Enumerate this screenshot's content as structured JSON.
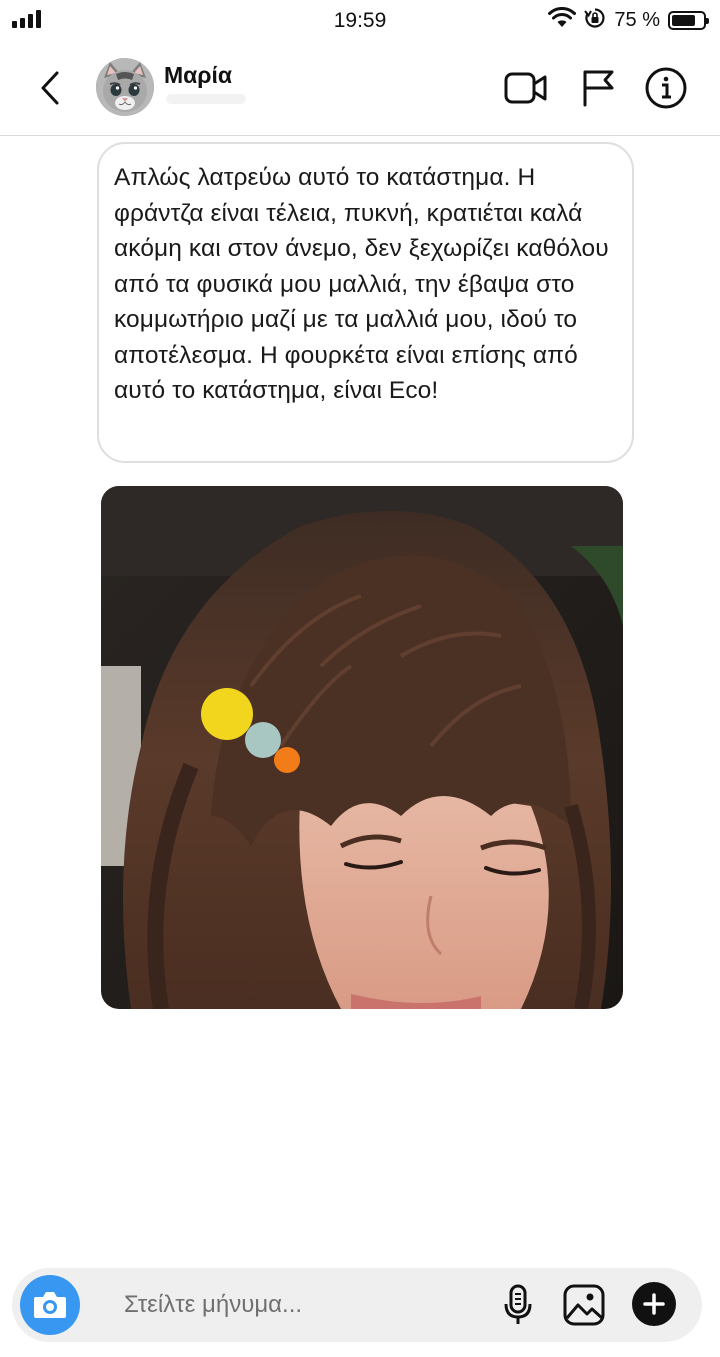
{
  "status_bar": {
    "time": "19:59",
    "battery_percent": "75 %",
    "battery_level": 0.75,
    "signal_bars": 4,
    "icons": [
      "signal-icon",
      "wifi-icon",
      "rotation-lock-icon",
      "battery-icon"
    ]
  },
  "header": {
    "contact_name": "Μαρία",
    "icons": [
      "back-chevron-icon",
      "video-call-icon",
      "flag-icon",
      "info-icon"
    ]
  },
  "conversation": {
    "message_text": "Απλώς λατρεύω αυτό το κατάστημα. Η φράντζα είναι τέλεια, πυκνή, κρατιέται καλά ακόμη και στον άνεμο, δεν ξεχωρίζει καθόλου από τα φυσικά μου μαλλιά, την έβαψα στο κομμωτήριο μαζί με τα μαλλιά μου, ιδού το αποτέλεσμα. Η φουρκέτα είναι επίσης από αυτό το κατάστημα, είναι Eco!"
  },
  "composer": {
    "placeholder": "Στείλτε μήνυμα...",
    "icons": [
      "camera-icon",
      "microphone-icon",
      "gallery-icon",
      "plus-icon"
    ]
  },
  "colors": {
    "accent": "#3897f0",
    "bubble_border": "#dedede",
    "composer_bg": "#efefef"
  }
}
